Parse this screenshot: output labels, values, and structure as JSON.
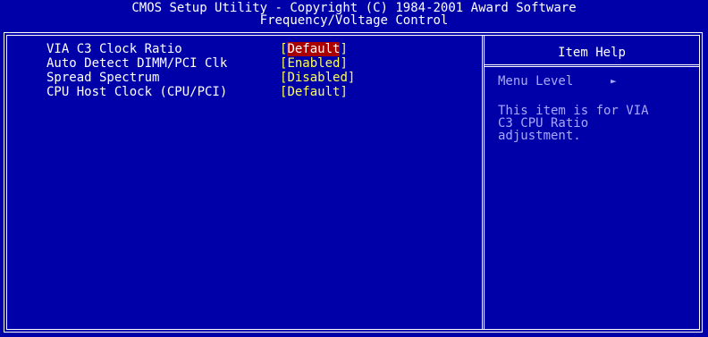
{
  "header": {
    "title_line1": "CMOS Setup Utility - Copyright (C) 1984-2001 Award Software",
    "title_line2": "Frequency/Voltage Control"
  },
  "menu": {
    "items": [
      {
        "label": "VIA C3 Clock Ratio",
        "value": "Default",
        "selected": true
      },
      {
        "label": "Auto Detect DIMM/PCI Clk",
        "value": "Enabled",
        "selected": false
      },
      {
        "label": "Spread Spectrum",
        "value": "Disabled",
        "selected": false
      },
      {
        "label": "CPU Host Clock (CPU/PCI)",
        "value": "Default",
        "selected": false
      }
    ]
  },
  "help": {
    "title": "Item Help",
    "menu_level_label": "Menu Level",
    "menu_level_arrow": "►",
    "text_lines": [
      "This item is for VIA",
      "C3 CPU Ratio",
      "adjustment."
    ]
  },
  "colors": {
    "background": "#0000a8",
    "label": "#ffffff",
    "value": "#ffff54",
    "selected_bg": "#a80000",
    "help_text": "#a8a8ff"
  }
}
